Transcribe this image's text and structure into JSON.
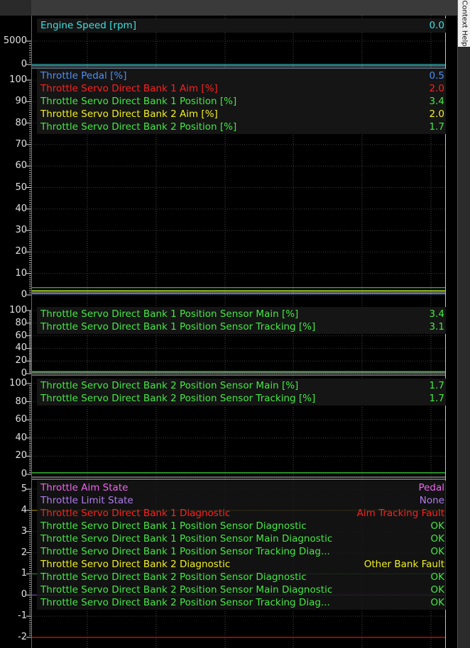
{
  "sidebar": {
    "label": "Context Help"
  },
  "chart_data": [
    {
      "type": "line",
      "panel": "engine",
      "ylim": [
        0,
        5000
      ],
      "yticks": [
        {
          "v": "5000",
          "val": 5000
        },
        {
          "v": "0",
          "val": 0
        }
      ],
      "channels": [
        {
          "label": "Engine Speed [rpm]",
          "value": "0.0",
          "color": "#3ee0e0"
        }
      ]
    },
    {
      "type": "line",
      "panel": "throttle",
      "ylim": [
        0,
        100
      ],
      "yticks": [
        {
          "v": "100",
          "val": 100
        },
        {
          "v": "90",
          "val": 90
        },
        {
          "v": "80",
          "val": 80
        },
        {
          "v": "70",
          "val": 70
        },
        {
          "v": "60",
          "val": 60
        },
        {
          "v": "50",
          "val": 50
        },
        {
          "v": "40",
          "val": 40
        },
        {
          "v": "30",
          "val": 30
        },
        {
          "v": "20",
          "val": 20
        },
        {
          "v": "10",
          "val": 10
        },
        {
          "v": "0",
          "val": 0
        }
      ],
      "channels": [
        {
          "label": "Throttle Pedal [%]",
          "value": "0.5",
          "color": "#4f8ff0"
        },
        {
          "label": "Throttle Servo Direct Bank 1 Aim [%]",
          "value": "2.0",
          "color": "#ff2020"
        },
        {
          "label": "Throttle Servo Direct Bank 1 Position [%]",
          "value": "3.4",
          "color": "#44e844"
        },
        {
          "label": "Throttle Servo Direct Bank 2 Aim [%]",
          "value": "2.0",
          "color": "#f0f020"
        },
        {
          "label": "Throttle Servo Direct Bank 2 Position [%]",
          "value": "1.7",
          "color": "#44e844"
        }
      ]
    },
    {
      "type": "line",
      "panel": "bank1",
      "ylim": [
        0,
        100
      ],
      "yticks": [
        {
          "v": "100",
          "val": 100
        },
        {
          "v": "80",
          "val": 80
        },
        {
          "v": "60",
          "val": 60
        },
        {
          "v": "40",
          "val": 40
        },
        {
          "v": "20",
          "val": 20
        },
        {
          "v": "0",
          "val": 0
        }
      ],
      "channels": [
        {
          "label": "Throttle Servo Direct Bank 1 Position Sensor Main [%]",
          "value": "3.4",
          "color": "#44e844"
        },
        {
          "label": "Throttle Servo Direct Bank 1 Position Sensor Tracking [%]",
          "value": "3.1",
          "color": "#44e844"
        }
      ]
    },
    {
      "type": "line",
      "panel": "bank2",
      "ylim": [
        0,
        100
      ],
      "yticks": [
        {
          "v": "100",
          "val": 100
        },
        {
          "v": "80",
          "val": 80
        },
        {
          "v": "60",
          "val": 60
        },
        {
          "v": "40",
          "val": 40
        },
        {
          "v": "20",
          "val": 20
        },
        {
          "v": "0",
          "val": 0
        }
      ],
      "channels": [
        {
          "label": "Throttle Servo Direct Bank 2 Position Sensor Main [%]",
          "value": "1.7",
          "color": "#44e844"
        },
        {
          "label": "Throttle Servo Direct Bank 2 Position Sensor Tracking [%]",
          "value": "1.7",
          "color": "#44e844"
        }
      ]
    },
    {
      "type": "line",
      "panel": "states",
      "ylim": [
        -2,
        5
      ],
      "yticks": [
        {
          "v": "5",
          "val": 5
        },
        {
          "v": "4",
          "val": 4
        },
        {
          "v": "3",
          "val": 3
        },
        {
          "v": "2",
          "val": 2
        },
        {
          "v": "1",
          "val": 1
        },
        {
          "v": "0",
          "val": 0
        },
        {
          "v": "-1",
          "val": -1
        },
        {
          "v": "-2",
          "val": -2
        }
      ],
      "channels": [
        {
          "label": "Throttle Aim State",
          "value": "Pedal",
          "color": "#ee66ee"
        },
        {
          "label": "Throttle Limit State",
          "value": "None",
          "color": "#b07cf0"
        },
        {
          "label": "Throttle Servo Direct Bank 1 Diagnostic",
          "value": "Aim Tracking Fault",
          "color": "#ff2020"
        },
        {
          "label": "Throttle Servo Direct Bank 1 Position Sensor Diagnostic",
          "value": "OK",
          "color": "#44e844"
        },
        {
          "label": "Throttle Servo Direct Bank 1 Position Sensor Main Diagnostic",
          "value": "OK",
          "color": "#44e844"
        },
        {
          "label": "Throttle Servo Direct Bank 1 Position Sensor Tracking Diag...",
          "value": "OK",
          "color": "#44e844"
        },
        {
          "label": "Throttle Servo Direct Bank 2 Diagnostic",
          "value": "Other Bank Fault",
          "color": "#f0f020"
        },
        {
          "label": "Throttle Servo Direct Bank 2 Position Sensor Diagnostic",
          "value": "OK",
          "color": "#44e844"
        },
        {
          "label": "Throttle Servo Direct Bank 2 Position Sensor Main Diagnostic",
          "value": "OK",
          "color": "#44e844"
        },
        {
          "label": "Throttle Servo Direct Bank 2 Position Sensor Tracking Diag...",
          "value": "OK",
          "color": "#44e844"
        }
      ],
      "traces": [
        {
          "val": 4,
          "color": "#b8a000"
        },
        {
          "val": 1,
          "color": "#2f9a2f"
        },
        {
          "val": 0,
          "color": "#8a5fd0"
        },
        {
          "val": -2,
          "color": "#ff2020"
        }
      ]
    }
  ]
}
